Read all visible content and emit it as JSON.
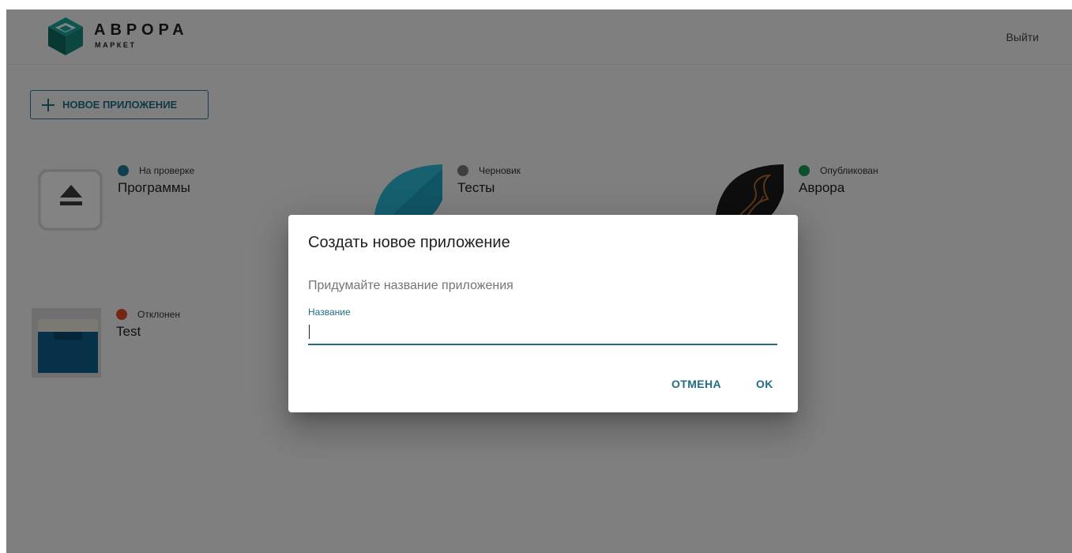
{
  "header": {
    "brand_title": "АВРОРА",
    "brand_subtitle": "МАРКЕТ",
    "logout_label": "Выйти"
  },
  "toolbar": {
    "new_app_label": "НОВОЕ ПРИЛОЖЕНИЕ"
  },
  "apps": [
    {
      "status": "На проверке",
      "status_color": "#1f7a96",
      "name": "Программы"
    },
    {
      "status": "Черновик",
      "status_color": "#7a7a7a",
      "name": "Тесты"
    },
    {
      "status": "Опубликован",
      "status_color": "#1a9a55",
      "name": "Аврора"
    },
    {
      "status": "Отклонен",
      "status_color": "#e04a2a",
      "name": "Test"
    }
  ],
  "dialog": {
    "title": "Создать новое приложение",
    "prompt": "Придумайте название приложения",
    "field_label": "Название",
    "field_value": "",
    "cancel_label": "ОТМЕНА",
    "ok_label": "OK"
  }
}
